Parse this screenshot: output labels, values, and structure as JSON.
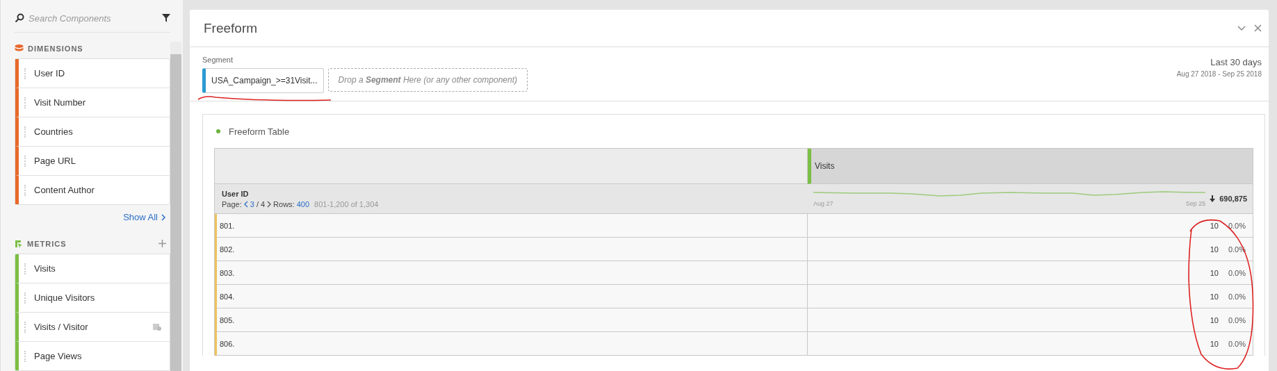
{
  "sidebar": {
    "search": {
      "placeholder": "Search Components"
    },
    "sections": [
      {
        "kind": "dimensions",
        "title": "DIMENSIONS",
        "items": [
          {
            "label": "User ID"
          },
          {
            "label": "Visit Number"
          },
          {
            "label": "Countries"
          },
          {
            "label": "Page URL"
          },
          {
            "label": "Content Author"
          }
        ],
        "link": "Show All"
      },
      {
        "kind": "metrics",
        "title": "METRICS",
        "items": [
          {
            "label": "Visits",
            "calculated": false
          },
          {
            "label": "Unique Visitors",
            "calculated": false
          },
          {
            "label": "Visits / Visitor",
            "calculated": true
          },
          {
            "label": "Page Views",
            "calculated": false
          }
        ]
      }
    ]
  },
  "panel": {
    "title": "Freeform",
    "segment": {
      "label": "Segment",
      "chip": "USA_Campaign_>=31Visit...",
      "dropzone": "Drop a **Segment** Here (or any other component)"
    },
    "date_range": {
      "title": "Last 30 days",
      "range": "Aug 27 2018 - Sep 25 2018"
    },
    "table": {
      "title": "Freeform Table",
      "metric_column": "Visits",
      "dimension": "User ID",
      "pagination": {
        "label": "Page:",
        "page": "3",
        "of": "/ 4",
        "rows_label": "Rows:",
        "rows": "400",
        "range": "801-1,200 of 1,304"
      },
      "sparkline": {
        "start": "Aug 27",
        "end": "Sep 25"
      },
      "total": "690,875",
      "rows": [
        {
          "label": "801.",
          "value": "10",
          "percent": "0.0%"
        },
        {
          "label": "802.",
          "value": "10",
          "percent": "0.0%"
        },
        {
          "label": "803.",
          "value": "10",
          "percent": "0.0%"
        },
        {
          "label": "804.",
          "value": "10",
          "percent": "0.0%"
        },
        {
          "label": "805.",
          "value": "10",
          "percent": "0.0%"
        },
        {
          "label": "806.",
          "value": "10",
          "percent": "0.0%"
        }
      ]
    }
  }
}
